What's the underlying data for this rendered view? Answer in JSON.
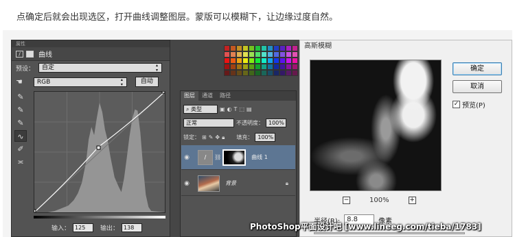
{
  "caption": "点确定后就会出现选区，打开曲线调整图层。蒙版可以模糊下，让边缘过度自然。",
  "properties_panel": {
    "tab_label": "属性",
    "title": "曲线",
    "preset_label": "预设：",
    "preset_value": "自定",
    "channel_value": "RGB",
    "auto_button": "自动",
    "input_label": "输入：",
    "input_value": "125",
    "output_label": "输出：",
    "output_value": "138",
    "tools": [
      "eyedropper-black-icon",
      "eyedropper-gray-icon",
      "eyedropper-white-icon",
      "curve-edit-icon",
      "pencil-icon",
      "smooth-icon"
    ]
  },
  "curve": {
    "points": [
      [
        0,
        0
      ],
      [
        125,
        138
      ],
      [
        255,
        255
      ]
    ]
  },
  "layers_panel": {
    "tabs": [
      "图层",
      "通道",
      "路径"
    ],
    "filter_label": "类型",
    "blend_mode": "正常",
    "opacity_label": "不透明度：",
    "opacity_value": "100%",
    "lock_label": "锁定：",
    "fill_label": "填充：",
    "fill_value": "100%",
    "layers": [
      {
        "name": "曲线 1",
        "selected": true
      },
      {
        "name": "背景",
        "selected": false
      }
    ]
  },
  "blur_dialog": {
    "title": "高斯模糊",
    "ok_button": "确定",
    "cancel_button": "取消",
    "preview_label": "预览(P)",
    "preview_checked": true,
    "zoom_value": "100%",
    "zoom_minus": "−",
    "zoom_plus": "+",
    "radius_label": "半径(R):",
    "radius_value": "8.8",
    "radius_unit": "像素"
  },
  "watermark": "PhotoShop平面设计吧 [www.lineeg.com/tieba/1783]"
}
